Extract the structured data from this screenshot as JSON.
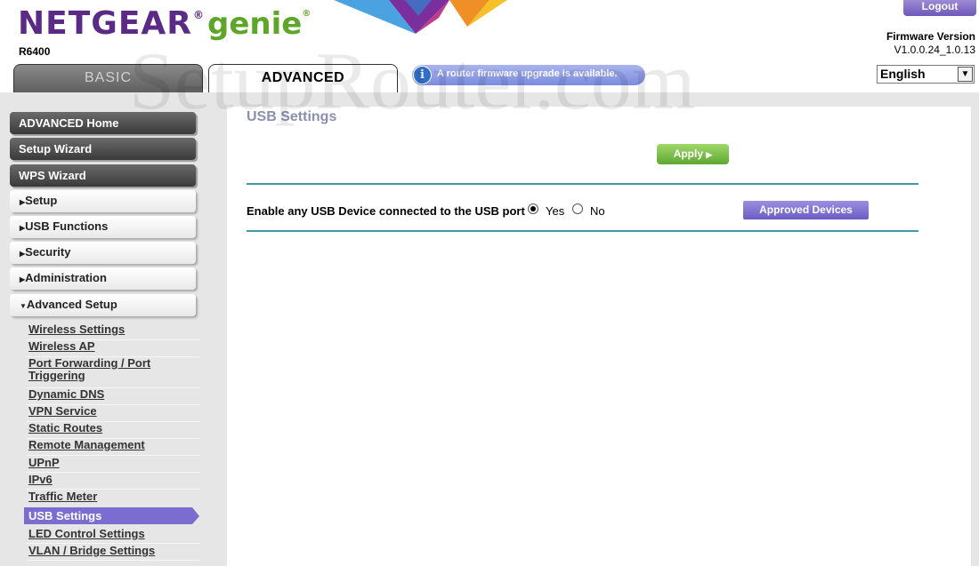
{
  "header": {
    "logo_brand": "NETGEAR",
    "logo_reg": "®",
    "logo_product": "genie",
    "logo_reg2": "®",
    "model": "R6400",
    "logout_label": "Logout",
    "firmware_label": "Firmware Version",
    "firmware_value": "V1.0.0.24_1.0.13",
    "language": "English"
  },
  "tabs": [
    {
      "label": "BASIC",
      "active": false
    },
    {
      "label": "ADVANCED",
      "active": true
    }
  ],
  "notice": {
    "text": "A router firmware upgrade is available.",
    "icon": "info-icon"
  },
  "watermark": "SetupRouter.com",
  "sidebar": {
    "buttons": [
      "ADVANCED Home",
      "Setup Wizard",
      "WPS Wizard"
    ],
    "sections": [
      {
        "label": "Setup",
        "expanded": false
      },
      {
        "label": "USB Functions",
        "expanded": false
      },
      {
        "label": "Security",
        "expanded": false
      },
      {
        "label": "Administration",
        "expanded": false
      },
      {
        "label": "Advanced Setup",
        "expanded": true
      }
    ],
    "section_arrow_collapsed": "▶",
    "section_arrow_expanded": "▼",
    "subitems": [
      "Wireless Settings",
      "Wireless AP",
      "Port Forwarding / Port Triggering",
      "Dynamic DNS",
      "VPN Service",
      "Static Routes",
      "Remote Management",
      "UPnP",
      "IPv6",
      "Traffic Meter",
      "USB Settings",
      "LED Control Settings",
      "VLAN / Bridge Settings"
    ],
    "subitem_port_line1": "Port Forwarding / Port",
    "subitem_port_line2": "Triggering",
    "active_subitem": "USB Settings"
  },
  "main": {
    "title": "USB Settings",
    "apply_label": "Apply",
    "apply_arrow": "▶",
    "usb_question": "Enable any USB Device connected to the USB port",
    "options": [
      "Yes",
      "No"
    ],
    "selected_option": "Yes",
    "approved_devices_label": "Approved Devices"
  },
  "colors": {
    "brand_purple": "#5a2a86",
    "brand_green": "#5ea629",
    "accent_teal": "#3f9aa1",
    "active_item": "#7b6cd0"
  }
}
